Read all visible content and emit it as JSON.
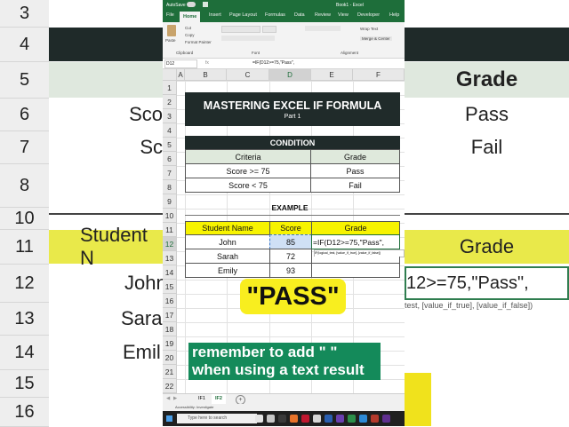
{
  "background": {
    "row_numbers": [
      "3",
      "5",
      "6",
      "7",
      "8",
      "11",
      "12",
      "13",
      "14",
      "15",
      "16"
    ],
    "grade_header": "Grade",
    "pass": "Pass",
    "fail": "Fail",
    "score_fragment_1": "Sco",
    "score_fragment_2": "Sc",
    "student_fragment": "Student N",
    "john_fragment": "John",
    "sara_fragment": "Sara",
    "emil_fragment": "Emil",
    "formula_fragment": "12>=75,\"Pass\",",
    "hint_fragment": "test, [value_if_true], [value_if_false])",
    "overlay_pass": "\"PASS\"",
    "tip_text": "remember to add \" \" when using a text result"
  },
  "excel": {
    "autosave": "AutoSave",
    "title": "Book1 - Excel",
    "tabs": [
      "File",
      "Home",
      "Insert",
      "Page Layout",
      "Formulas",
      "Data",
      "Review",
      "View",
      "Developer",
      "Help"
    ],
    "active_tab": "Home",
    "ribbon": {
      "paste": "Paste",
      "cut": "Cut",
      "copy": "Copy",
      "format_painter": "Format Painter",
      "clipboard": "Clipboard",
      "font": "Font",
      "alignment": "Alignment",
      "wrap_text": "Wrap Text",
      "merge_center": "Merge & Center"
    },
    "name_box": "D12",
    "formula": "=IF(D12>=75,\"Pass\",",
    "columns": [
      "A",
      "B",
      "C",
      "D",
      "E",
      "F"
    ],
    "rows": [
      "1",
      "2",
      "3",
      "4",
      "5",
      "6",
      "7",
      "8",
      "9",
      "10",
      "11",
      "12",
      "13",
      "14",
      "15",
      "16",
      "17",
      "18",
      "19",
      "20",
      "21",
      "22"
    ],
    "heading": "MASTERING EXCEL IF FORMULA",
    "subheading": "Part 1",
    "condition_title": "CONDITION",
    "condition_headers": [
      "Criteria",
      "Grade"
    ],
    "condition_rows": [
      [
        "Score >= 75",
        "Pass"
      ],
      [
        "Score < 75",
        "Fail"
      ]
    ],
    "example_title": "EXAMPLE",
    "example_headers": [
      "Student Name",
      "Score",
      "Grade"
    ],
    "example_rows": [
      [
        "John",
        "85",
        ""
      ],
      [
        "Sarah",
        "72",
        ""
      ],
      [
        "Emily",
        "93",
        ""
      ]
    ],
    "editing_formula": "=IF(D12>=75,\"Pass\",",
    "tooltip": "IF(logical_test, [value_if_true], [value_if_false])",
    "sheet_tabs": [
      "IF1",
      "IF2"
    ],
    "active_sheet": "IF2",
    "status": "Accessibility: Investigate",
    "search_placeholder": "Type here to search"
  }
}
